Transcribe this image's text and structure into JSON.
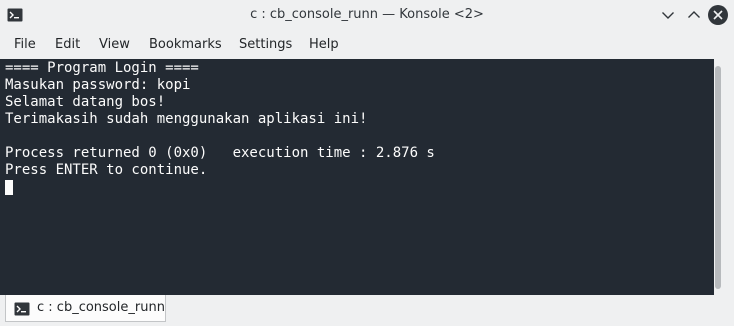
{
  "window": {
    "title": "c : cb_console_runn — Konsole <2>"
  },
  "menu": {
    "items": [
      "File",
      "Edit",
      "View",
      "Bookmarks",
      "Settings",
      "Help"
    ]
  },
  "terminal": {
    "lines": [
      "==== Program Login ====",
      "Masukan password: kopi",
      "Selamat datang bos!",
      "Terimakasih sudah menggunakan aplikasi ini!",
      "",
      "Process returned 0 (0x0)   execution time : 2.876 s",
      "Press ENTER to continue."
    ]
  },
  "tabs": [
    {
      "label": "c : cb_console_runn"
    }
  ],
  "colors": {
    "terminal_bg": "#232a33",
    "terminal_fg": "#fcfcfc",
    "chrome_bg": "#eff0f1",
    "close_button": "#31363b"
  },
  "icons": {
    "app": "terminal-icon",
    "minimize": "chevron-down-icon",
    "maximize": "chevron-up-icon",
    "close": "close-icon",
    "tab": "terminal-icon"
  }
}
